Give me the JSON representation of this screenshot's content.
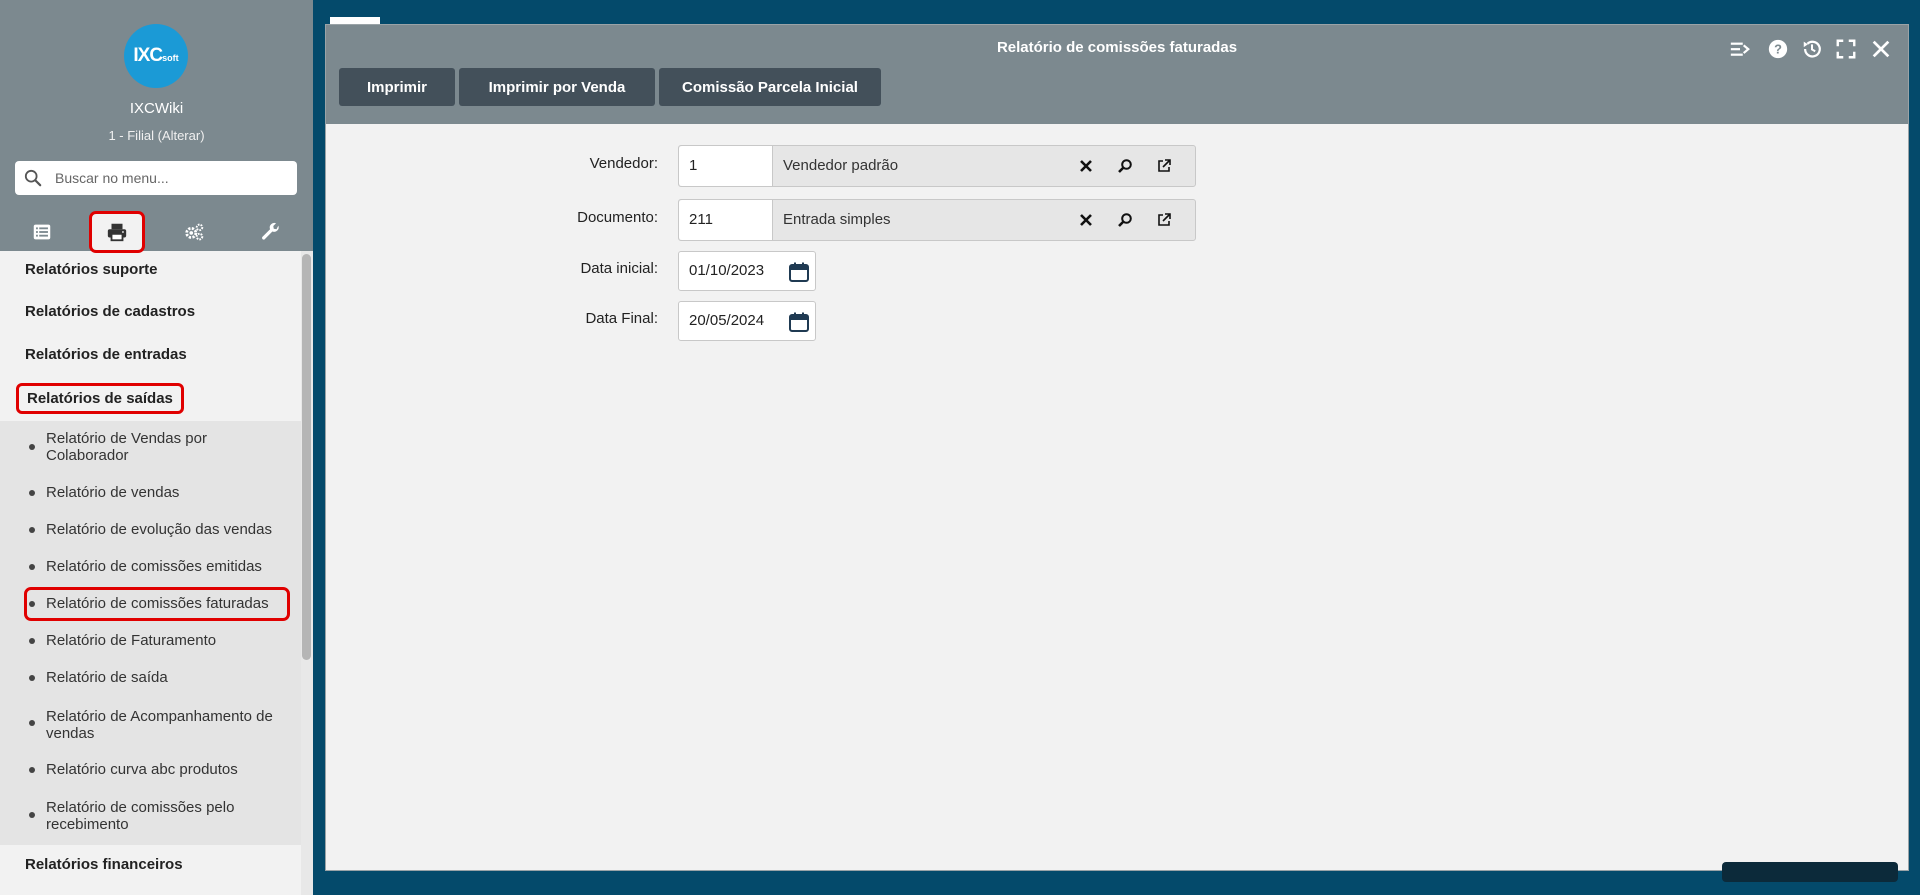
{
  "sidebar": {
    "logo_text": "IXCsoft",
    "company": "IXCWiki",
    "branch": "1 - Filial (Alterar)",
    "search_placeholder": "Buscar no menu...",
    "tab_icons": [
      "list-icon",
      "printer-icon",
      "gears-icon",
      "wrench-icon"
    ],
    "categories": {
      "suporte": "Relatórios suporte",
      "cadastros": "Relatórios de cadastros",
      "entradas": "Relatórios de entradas",
      "saidas": "Relatórios de saídas",
      "financeiros": "Relatórios financeiros"
    },
    "items": [
      "Relatório de Vendas por Colaborador",
      "Relatório de vendas",
      "Relatório de evolução das vendas",
      "Relatório de comissões emitidas",
      "Relatório de comissões faturadas",
      "Relatório de Faturamento",
      "Relatório de saída",
      "Relatório de Acompanhamento de vendas",
      "Relatório curva abc produtos",
      "Relatório de comissões pelo recebimento"
    ]
  },
  "window": {
    "title": "Relatório de comissões faturadas",
    "controls": [
      "collapse-icon",
      "help-icon",
      "history-icon",
      "fullscreen-icon",
      "close-icon"
    ],
    "buttons": {
      "imprimir": "Imprimir",
      "imprimir_venda": "Imprimir por Venda",
      "comissao": "Comissão Parcela Inicial"
    }
  },
  "form": {
    "vendedor": {
      "label": "Vendedor:",
      "code": "1",
      "desc": "Vendedor padrão"
    },
    "documento": {
      "label": "Documento:",
      "code": "211",
      "desc": "Entrada simples"
    },
    "data_inicial": {
      "label": "Data inicial:",
      "value": "01/10/2023"
    },
    "data_final": {
      "label": "Data Final:",
      "value": "20/05/2024"
    }
  },
  "colors": {
    "highlight": "#e00000",
    "header": "#7c898f",
    "button": "#43505a",
    "background": "#044a6b"
  }
}
